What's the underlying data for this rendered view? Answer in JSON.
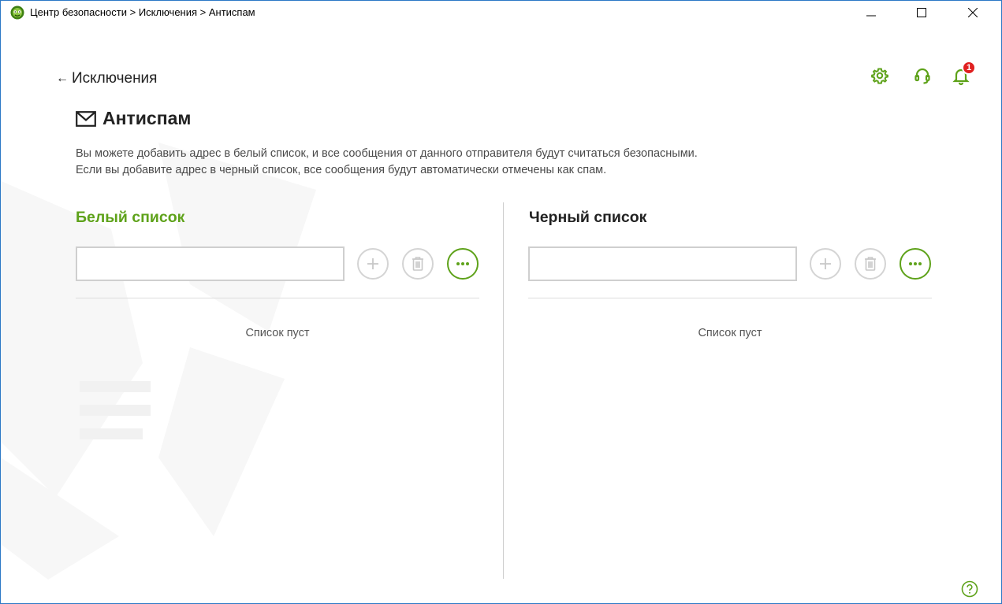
{
  "window": {
    "title": "Центр безопасности > Исключения > Антиспам"
  },
  "nav": {
    "back_label": "Исключения"
  },
  "page": {
    "title": "Антиспам",
    "description_line1": "Вы можете добавить адрес в белый список, и все сообщения от данного отправителя будут считаться безопасными.",
    "description_line2": "Если вы добавите адрес в черный список, все сообщения будут автоматически отмечены как спам."
  },
  "notifications": {
    "count": "1"
  },
  "whitelist": {
    "title": "Белый список",
    "input_value": "",
    "empty_text": "Список пуст"
  },
  "blacklist": {
    "title": "Черный список",
    "input_value": "",
    "empty_text": "Список пуст"
  },
  "icons": {
    "settings": "gear-icon",
    "support": "headset-icon",
    "notifications": "bell-icon",
    "add": "plus-icon",
    "delete": "trash-icon",
    "more": "more-icon",
    "help": "help-icon",
    "mail": "envelope-icon"
  },
  "colors": {
    "accent_green": "#5ea21a",
    "badge_red": "#e02020",
    "window_border": "#2b78c6"
  }
}
